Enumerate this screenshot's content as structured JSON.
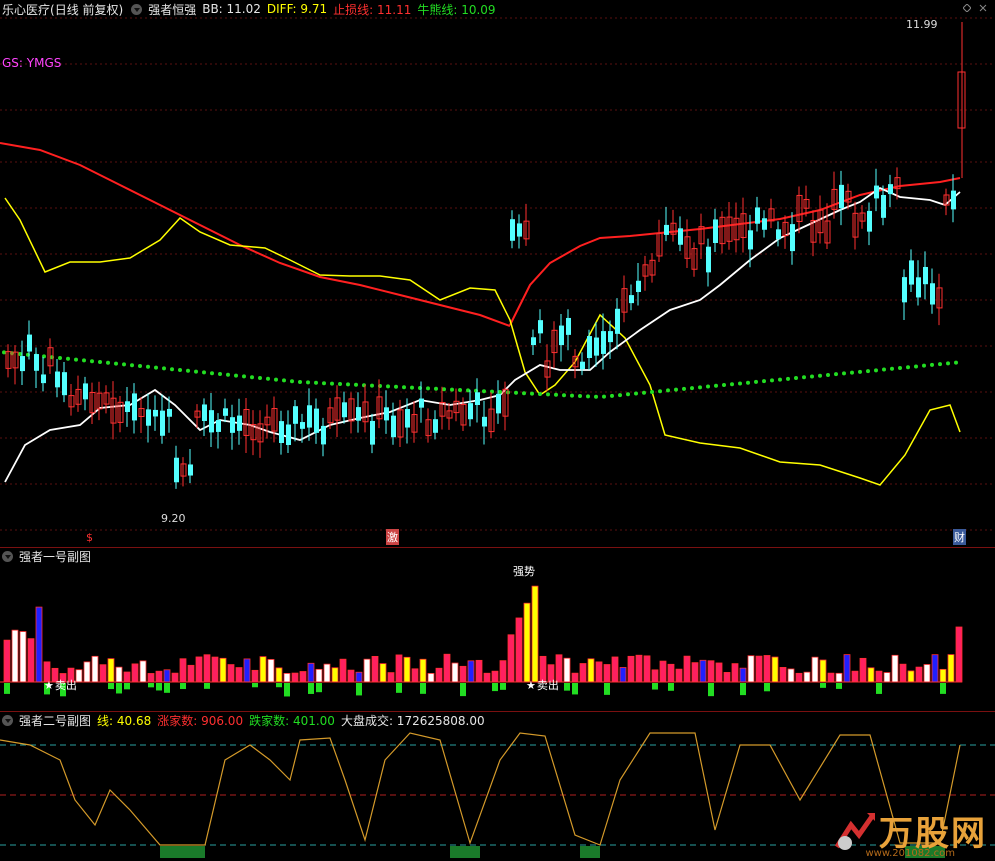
{
  "main_panel": {
    "stock_name": "乐心医疗",
    "period": "(日线 前复权)",
    "indicator_name": "强者恒强",
    "bb": "BB: 11.02",
    "diff": "DIFF: 9.71",
    "stop_loss": "止损线: 11.11",
    "bull_bear": "牛熊线: 10.09",
    "gs": "GS: YMGS",
    "high_label": "11.99",
    "low_label": "9.20",
    "marker_left": "$",
    "marker_mid": "激",
    "marker_right": "财"
  },
  "sub1": {
    "title": "强者一号副图",
    "strong_label": "强势",
    "sell_label_1": "卖出",
    "sell_label_2": "卖出"
  },
  "sub2": {
    "title": "强者二号副图",
    "line": "线: 40.68",
    "up_count": "涨家数: 906.00",
    "down_count": "跌家数: 401.00",
    "market_volume": "大盘成交: 172625808.00"
  },
  "watermark": {
    "text": "万股网",
    "site": "www.201082.com"
  },
  "colors": {
    "up": "#ff3030",
    "down": "#54ffff",
    "yellow": "#ffff00",
    "white": "#ffffff",
    "red_line": "#ff2020",
    "green_dots": "#22dd22",
    "separator": "#7a1010",
    "orange_line": "#d49a2a"
  }
}
